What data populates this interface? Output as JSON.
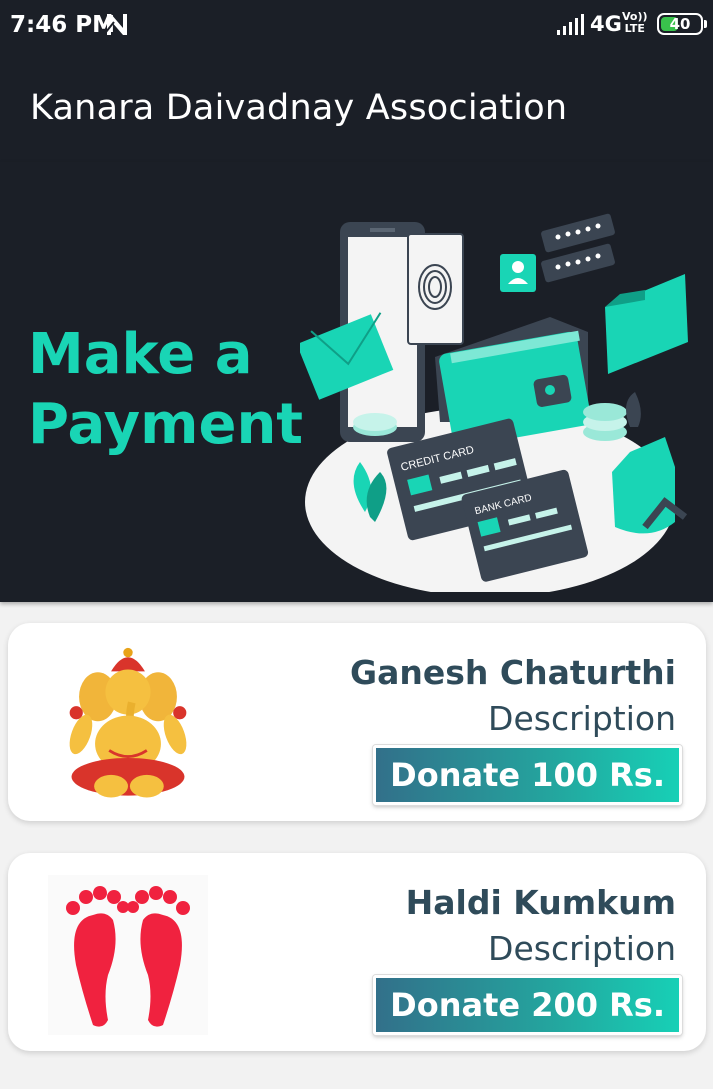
{
  "status_bar": {
    "time": "7:46 PM",
    "network": "4G",
    "volte_top": "Vo))",
    "volte_bottom": "LTE",
    "battery_level": "40",
    "battery_color": "#39c24c",
    "icons": [
      "n-notification-icon",
      "signal-icon",
      "battery-icon"
    ]
  },
  "app_bar": {
    "title": "Kanara Daivadnay Association"
  },
  "banner": {
    "line1": "Make a",
    "line2": "Payment",
    "accent_color": "#19d5b5",
    "illustration": {
      "credit_card_label": "CREDIT CARD",
      "bank_card_label": "BANK CARD"
    }
  },
  "donations": [
    {
      "title": "Ganesh Chaturthi",
      "description": "Description",
      "button_label": "Donate 100 Rs.",
      "image": "ganesha-image"
    },
    {
      "title": "Haldi Kumkum",
      "description": "Description",
      "button_label": "Donate 200 Rs.",
      "image": "footprints-image"
    }
  ]
}
